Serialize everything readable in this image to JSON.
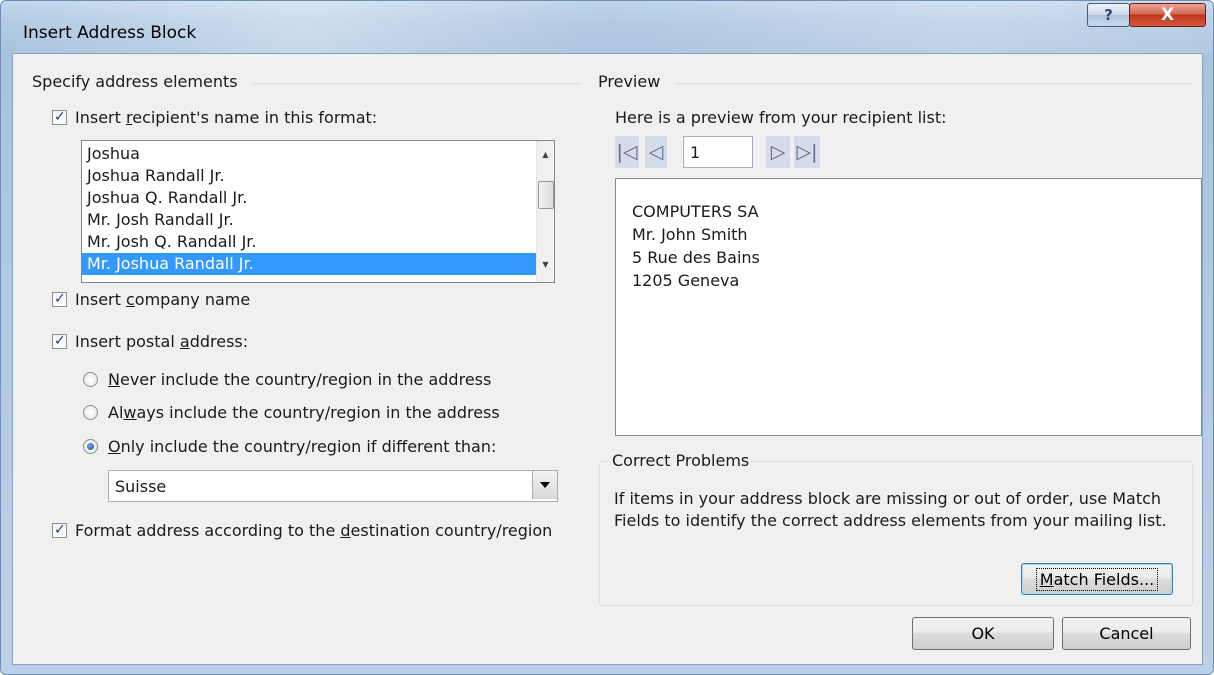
{
  "window": {
    "title": "Insert Address Block",
    "help_label": "?",
    "close_label": "X"
  },
  "address_elements": {
    "group_label": "Specify address elements",
    "insert_name": {
      "checked": true,
      "label_before": "Insert ",
      "label_accel": "r",
      "label_after": "ecipient's name in this format:"
    },
    "name_formats": [
      "Joshua",
      "Joshua Randall Jr.",
      "Joshua Q. Randall Jr.",
      "Mr. Josh Randall Jr.",
      "Mr. Josh Q. Randall Jr.",
      "Mr. Joshua Randall Jr."
    ],
    "selected_format_index": 5,
    "insert_company": {
      "checked": true,
      "label_before": "Insert ",
      "label_accel": "c",
      "label_after": "ompany name"
    },
    "insert_postal": {
      "checked": true,
      "label_before": "Insert postal ",
      "label_accel": "a",
      "label_after": "ddress:"
    },
    "country_options": [
      {
        "accel": "N",
        "rest": "ever include the country/region in the address",
        "selected": false
      },
      {
        "before": "Al",
        "accel": "w",
        "rest": "ays include the country/region in the address",
        "selected": false
      },
      {
        "accel": "O",
        "rest": "nly include the country/region if different than:",
        "selected": true
      }
    ],
    "country_value": "Suisse",
    "format_by_destination": {
      "checked": true,
      "label_before": "Format address according to the ",
      "label_accel": "d",
      "label_after": "estination country/region"
    }
  },
  "preview": {
    "group_label": "Preview",
    "intro": "Here is a preview from your recipient list:",
    "record_number": "1",
    "lines": [
      "COMPUTERS SA",
      "Mr. John Smith",
      "5 Rue des Bains",
      "1205 Geneva"
    ]
  },
  "correct_problems": {
    "group_label": "Correct Problems",
    "text": "If items in your address block are missing or out of order, use Match Fields to identify the correct address elements from your mailing list.",
    "match_fields_accel": "M",
    "match_fields_rest": "atch Fields..."
  },
  "buttons": {
    "ok": "OK",
    "cancel": "Cancel"
  }
}
